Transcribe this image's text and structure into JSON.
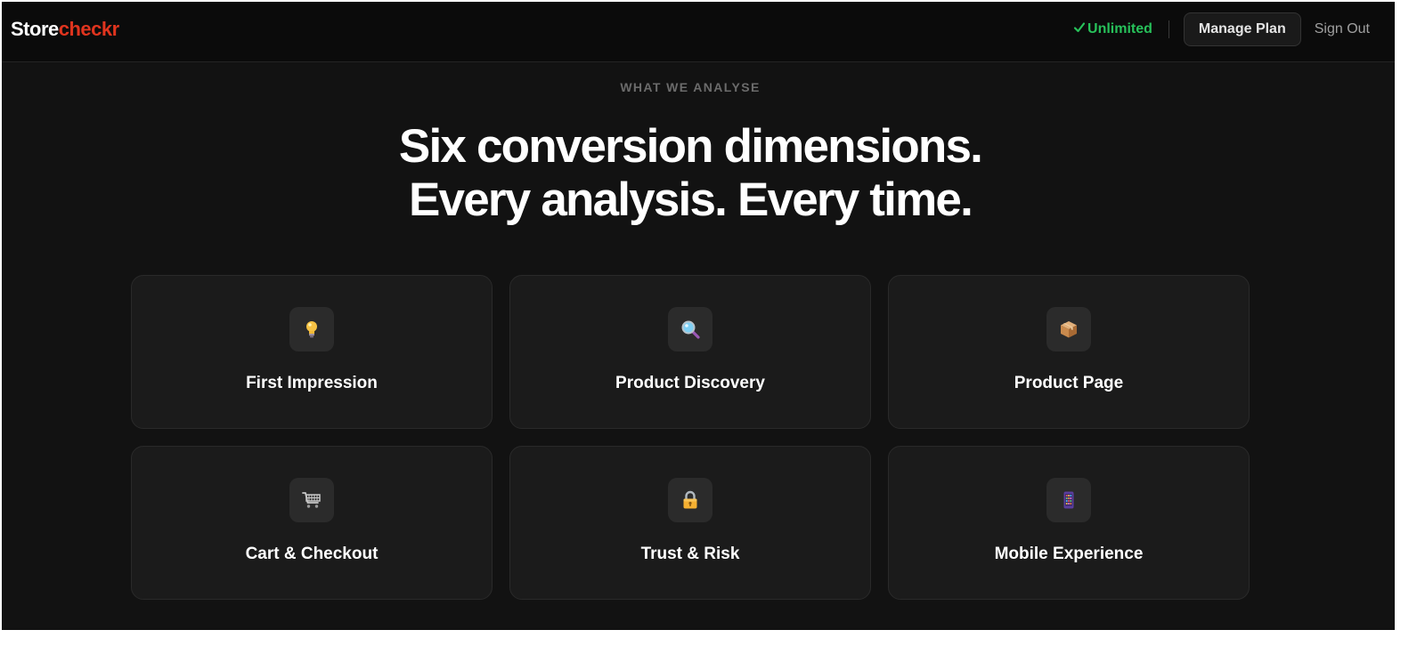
{
  "header": {
    "brand_part1": "Store",
    "brand_part2": "checkr",
    "status_label": "Unlimited",
    "status_icon": "check-icon",
    "manage_plan_label": "Manage Plan",
    "sign_out_label": "Sign Out"
  },
  "section": {
    "eyebrow": "WHAT WE ANALYSE",
    "headline_line1": "Six conversion dimensions.",
    "headline_line2": "Every analysis. Every time."
  },
  "cards": [
    {
      "icon": "lightbulb-icon",
      "title": "First Impression"
    },
    {
      "icon": "magnifying-glass-icon",
      "title": "Product Discovery"
    },
    {
      "icon": "package-icon",
      "title": "Product Page"
    },
    {
      "icon": "shopping-cart-icon",
      "title": "Cart & Checkout"
    },
    {
      "icon": "lock-icon",
      "title": "Trust & Risk"
    },
    {
      "icon": "mobile-phone-icon",
      "title": "Mobile Experience"
    }
  ],
  "colors": {
    "background": "#121212",
    "card_background": "#1b1b1b",
    "brand_accent": "#e0341e",
    "status_green": "#27c15a",
    "text_primary": "#ffffff",
    "text_muted": "#6b6b6b"
  }
}
